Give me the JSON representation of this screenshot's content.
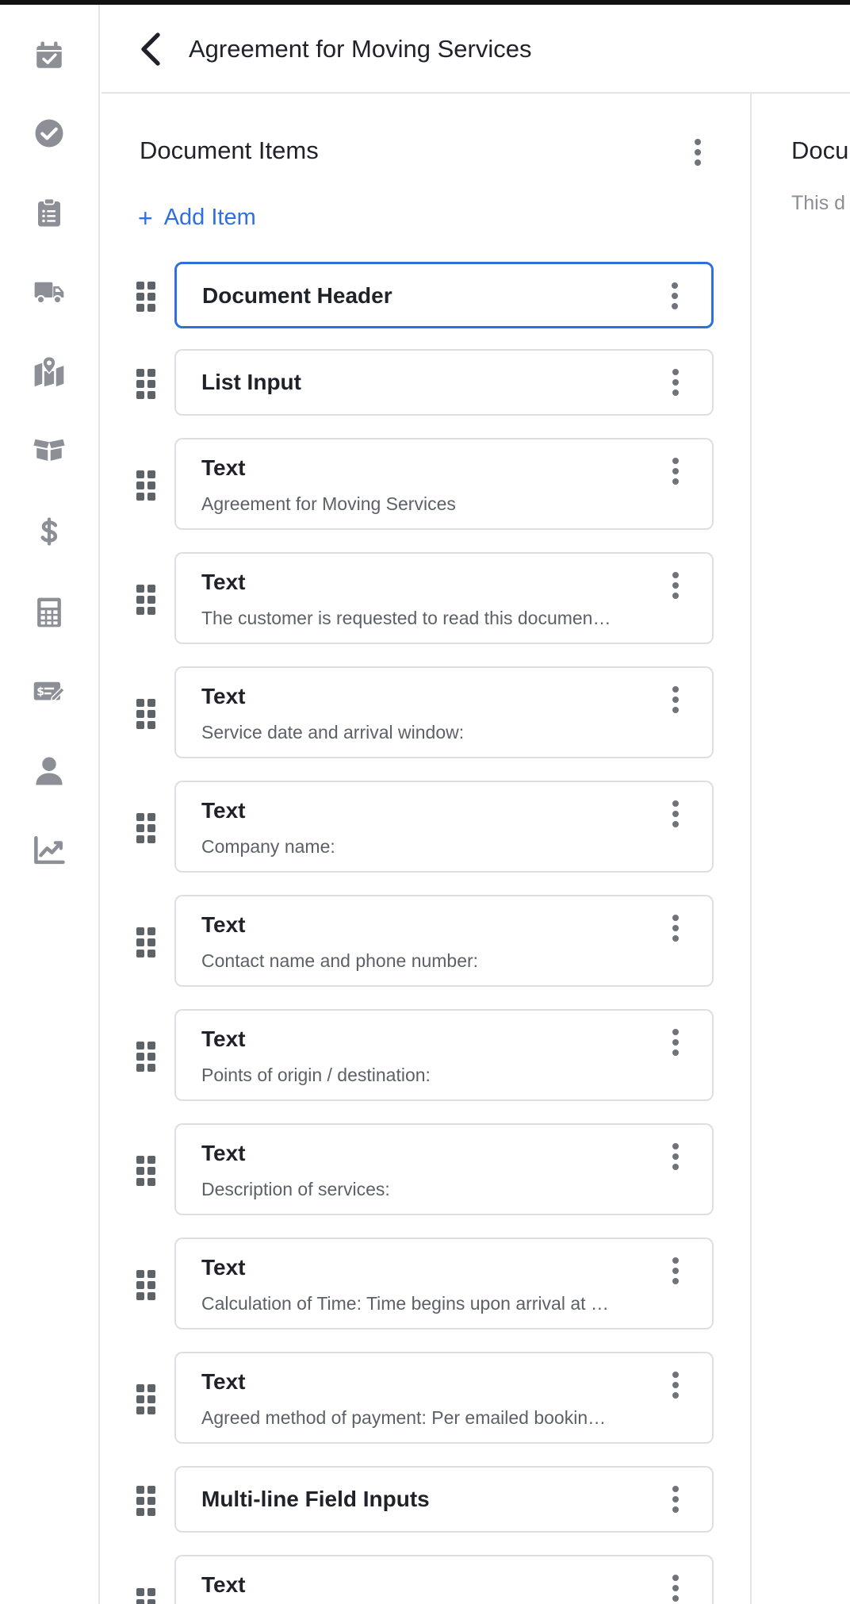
{
  "header": {
    "title": "Agreement for Moving Services",
    "back_icon": "chevron-left-icon"
  },
  "sidebar": {
    "items": [
      {
        "icon": "calendar-check-icon"
      },
      {
        "icon": "check-circle-icon"
      },
      {
        "icon": "clipboard-list-icon"
      },
      {
        "icon": "truck-icon"
      },
      {
        "icon": "map-marker-icon"
      },
      {
        "icon": "box-open-icon"
      },
      {
        "icon": "dollar-icon"
      },
      {
        "icon": "calculator-icon"
      },
      {
        "icon": "money-check-edit-icon"
      },
      {
        "icon": "user-icon"
      },
      {
        "icon": "chart-line-icon"
      }
    ]
  },
  "left_panel": {
    "title": "Document Items",
    "add_item": {
      "plus": "+",
      "label": "Add Item"
    },
    "items": [
      {
        "title": "Document Header",
        "subtitle": "",
        "selected": true
      },
      {
        "title": "List Input",
        "subtitle": ""
      },
      {
        "title": "Text",
        "subtitle": "Agreement for Moving Services"
      },
      {
        "title": "Text",
        "subtitle": "The customer is requested to read this documen…"
      },
      {
        "title": "Text",
        "subtitle": "Service date and arrival window:"
      },
      {
        "title": "Text",
        "subtitle": "Company name:"
      },
      {
        "title": "Text",
        "subtitle": "Contact name and phone number:"
      },
      {
        "title": "Text",
        "subtitle": "Points of origin / destination:"
      },
      {
        "title": "Text",
        "subtitle": "Description of services:"
      },
      {
        "title": "Text",
        "subtitle": "Calculation of Time: Time begins upon arrival at …"
      },
      {
        "title": "Text",
        "subtitle": "Agreed method of payment: Per emailed bookin…"
      },
      {
        "title": "Multi-line Field Inputs",
        "subtitle": ""
      },
      {
        "title": "Text",
        "subtitle": ""
      }
    ]
  },
  "right_panel": {
    "title": "Docu",
    "description": "This d"
  },
  "colors": {
    "accent": "#2f6fe0",
    "icon_gray": "#8c9096",
    "border": "#dcdfe3"
  }
}
